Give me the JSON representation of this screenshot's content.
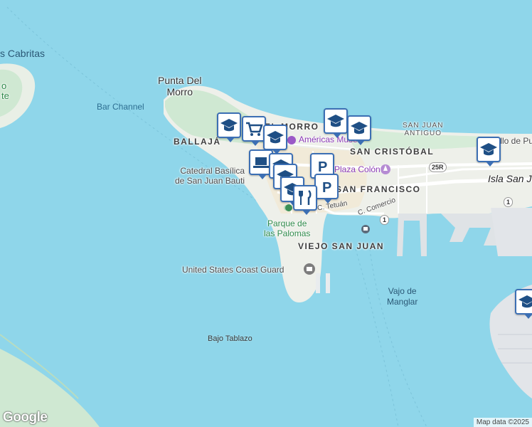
{
  "map": {
    "labels": {
      "cabritas": "s Cabritas",
      "punta_del_morro": "Punta Del\nMorro",
      "bar_channel": "Bar Channel",
      "ballaja": "BALLAJÁ",
      "el_morro": "EL MORRO",
      "catedral": "Catedral Basílica\nde San Juan Bauti",
      "americas_museum": "Américas Museu",
      "plaza_colon": "Plaza Colón",
      "san_cristobal": "SAN CRISTÓBAL",
      "san_juan_antiguo": "SAN JUAN\nANTIGUO",
      "san_francisco": "SAN FRANCISCO",
      "castillo": "Castillo de Pu",
      "isla_san_juan": "Isla San J",
      "c_tetuan": "C. Tetuán",
      "c_comercio": "C. Comercio",
      "parque_palomas": "Parque de\nlas Palomas",
      "viejo_san_juan": "VIEJO SAN JUAN",
      "coast_guard": "United States Coast Guard",
      "vajo_manglar": "Vajo de\nManglar",
      "bajo_tablazo": "Bajo Tablazo",
      "left_partial": "o\nte"
    },
    "road_shields": {
      "r25r": "25R",
      "r1a": "1",
      "r1b": "1"
    },
    "brand": "Google",
    "attribution": "Map data ©2025"
  },
  "markers": [
    {
      "icon": "school-icon"
    },
    {
      "icon": "shopping-cart-icon"
    },
    {
      "icon": "school-icon"
    },
    {
      "icon": "school-icon"
    },
    {
      "icon": "school-icon"
    },
    {
      "icon": "laptop-icon"
    },
    {
      "icon": "parking-icon"
    },
    {
      "icon": "restaurant-icon"
    },
    {
      "icon": "school-icon"
    }
  ],
  "colors": {
    "water": "#8fd6ea",
    "land": "#eef0ea",
    "park": "#cfe8d2",
    "marker_border": "#3c6fb4",
    "marker_icon": "#1f4f85"
  }
}
